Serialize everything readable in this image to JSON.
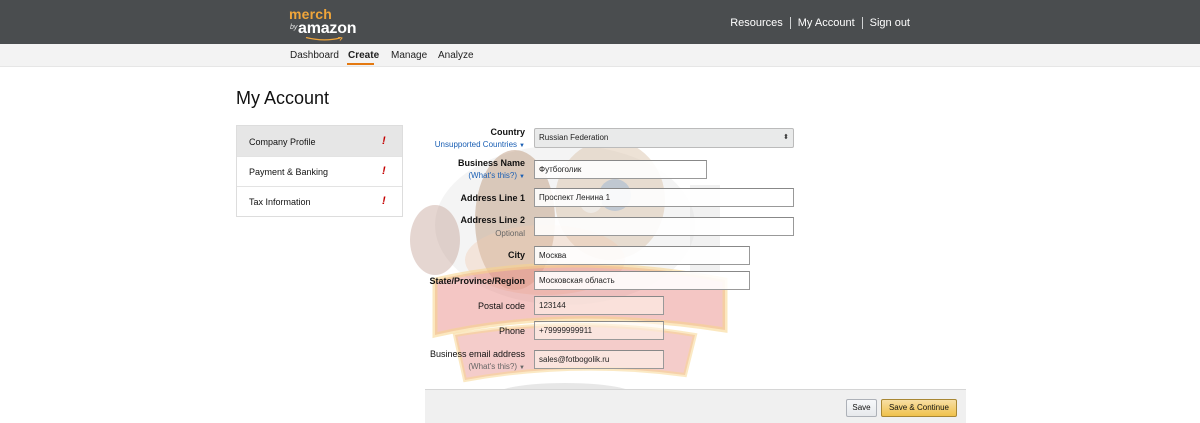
{
  "header": {
    "logo": {
      "merch": "merch",
      "by": "by",
      "amazon": "amazon"
    },
    "links": [
      "Resources",
      "My Account",
      "Sign out"
    ]
  },
  "nav": {
    "tabs": [
      "Dashboard",
      "Create",
      "Manage",
      "Analyze"
    ],
    "active": "Create"
  },
  "page_title": "My Account",
  "sidebar": {
    "items": [
      {
        "label": "Company Profile",
        "alert": "!",
        "active": true
      },
      {
        "label": "Payment & Banking",
        "alert": "!"
      },
      {
        "label": "Tax Information",
        "alert": "!"
      }
    ]
  },
  "form": {
    "country": {
      "label": "Country",
      "sub": "Unsupported Countries",
      "value": "Russian Federation"
    },
    "business_name": {
      "label": "Business Name",
      "sub": "(What's this?)",
      "value": "Футбоголик"
    },
    "address1": {
      "label": "Address Line 1",
      "value": "Проспект Ленина 1"
    },
    "address2": {
      "label": "Address Line 2",
      "sub": "Optional",
      "value": ""
    },
    "city": {
      "label": "City",
      "value": "Москва"
    },
    "state": {
      "label": "State/Province/Region",
      "value": "Московская область"
    },
    "postal": {
      "label": "Postal code",
      "value": "123144"
    },
    "phone": {
      "label": "Phone",
      "value": "+79999999911"
    },
    "email": {
      "label": "Business email address",
      "sub": "(What's this?)",
      "value": "sales@fotbogolik.ru"
    }
  },
  "actions": {
    "save": "Save",
    "save_continue": "Save & Continue"
  },
  "colors": {
    "header_bg": "#4a4d4f",
    "accent_orange": "#e47911",
    "alert_red": "#c40000",
    "primary_button": "#f0c14b"
  },
  "icons": {
    "dropdown": "triangle-down",
    "select": "up-down-arrows"
  }
}
